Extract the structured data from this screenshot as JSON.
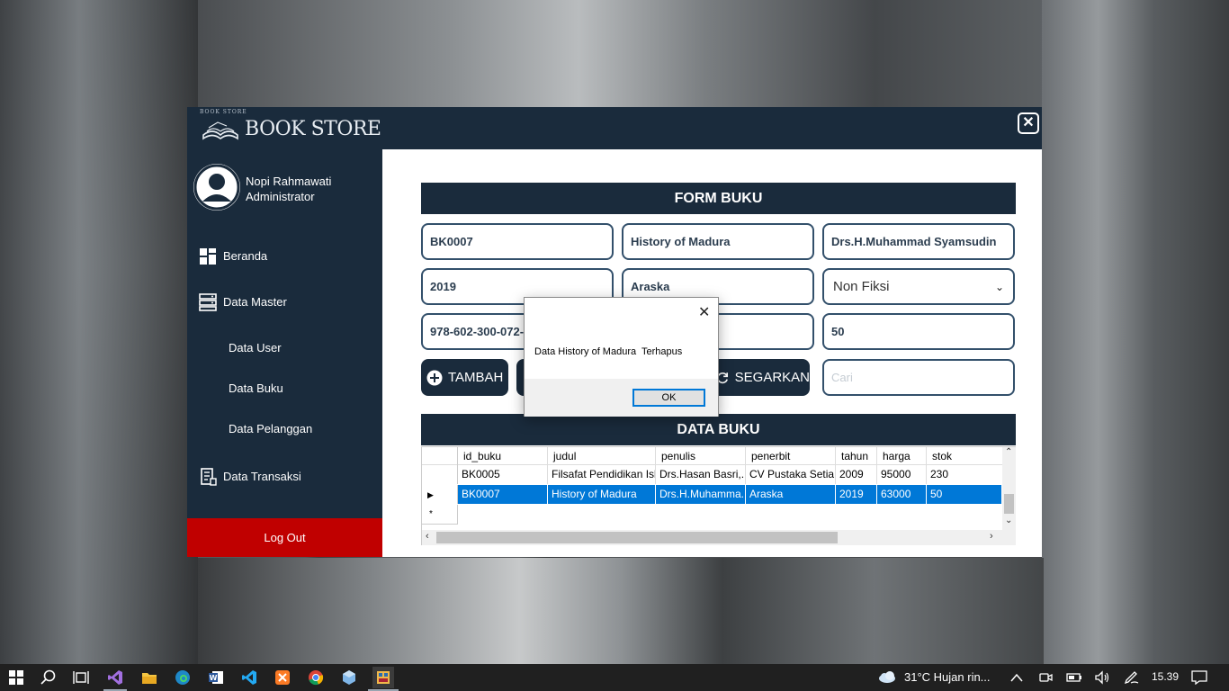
{
  "app": {
    "logo_text": "BOOK STORE",
    "logo_small": "BOOK STORE",
    "close_label": "✕"
  },
  "sidebar": {
    "user_name": "Nopi Rahmawati",
    "user_role": "Administrator",
    "items": [
      {
        "label": "Beranda"
      },
      {
        "label": "Data Master"
      },
      {
        "label": "Data User"
      },
      {
        "label": "Data Buku"
      },
      {
        "label": "Data Pelanggan"
      },
      {
        "label": "Data Transaksi"
      }
    ],
    "logout": "Log Out"
  },
  "form": {
    "title": "FORM BUKU",
    "id_buku": "BK0007",
    "judul": "History of Madura",
    "penulis": "Drs.H.Muhammad Syamsudin",
    "tahun": "2019",
    "penerbit": "Araska",
    "kategori": "Non Fiksi",
    "isbn": "978-602-300-072-",
    "stok": "50",
    "search_placeholder": "Cari",
    "btn_tambah": "TAMBAH",
    "btn_segarkan": "SEGARKAN"
  },
  "table": {
    "title": "DATA BUKU",
    "columns": [
      "id_buku",
      "judul",
      "penulis",
      "penerbit",
      "tahun",
      "harga",
      "stok"
    ],
    "rows": [
      [
        "BK0005",
        "Filsafat Pendidikan Isl...",
        "Drs.Hasan Basri,...",
        "CV Pustaka Setia...",
        "2009",
        "95000",
        "230"
      ],
      [
        "BK0007",
        "History of Madura",
        "Drs.H.Muhamma...",
        "Araska",
        "2019",
        "63000",
        "50"
      ]
    ],
    "new_row_marker": "*"
  },
  "dialog": {
    "message": "Data History of Madura  Terhapus",
    "ok": "OK",
    "close": "✕"
  },
  "taskbar": {
    "weather": "31°C  Hujan rin...",
    "time": "15.39"
  },
  "colors": {
    "navy": "#1a2b3c",
    "logout_red": "#c00000",
    "selection_blue": "#0078d7"
  }
}
